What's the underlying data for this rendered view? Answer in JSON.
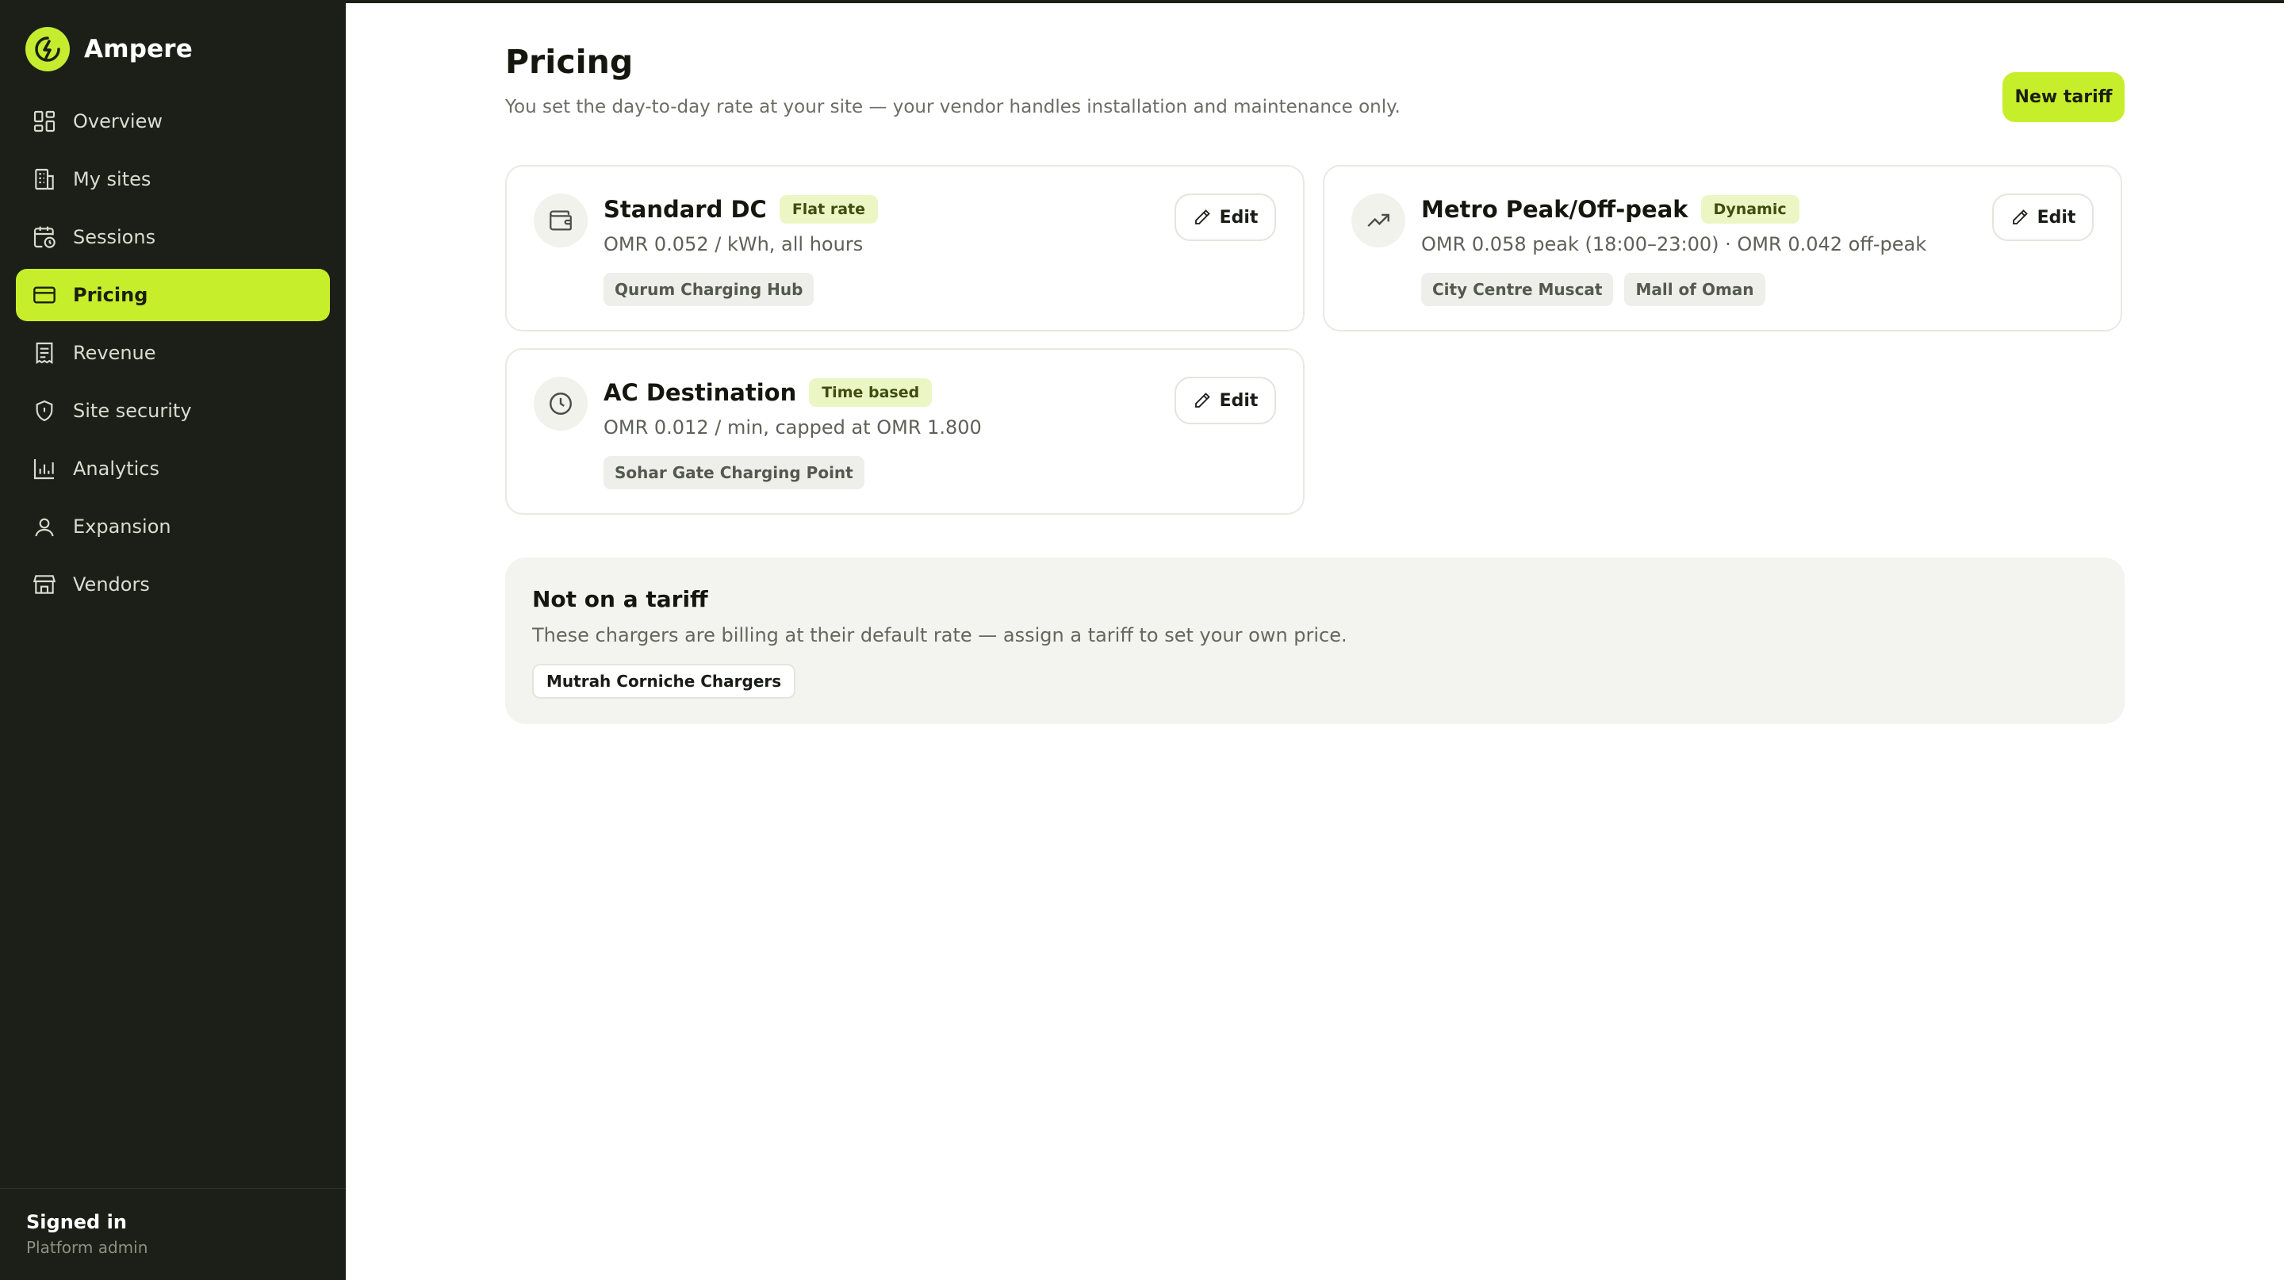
{
  "app": {
    "name": "Ampere",
    "accent": "#c7ee2b",
    "sidebar_bg": "#1c1f17"
  },
  "sidebar": {
    "items": [
      {
        "label": "Overview",
        "icon": "grid-icon"
      },
      {
        "label": "My sites",
        "icon": "building-icon"
      },
      {
        "label": "Sessions",
        "icon": "calendar-clock-icon"
      },
      {
        "label": "Pricing",
        "icon": "credit-card-icon",
        "active": true
      },
      {
        "label": "Revenue",
        "icon": "receipt-icon"
      },
      {
        "label": "Site security",
        "icon": "shield-icon"
      },
      {
        "label": "Analytics",
        "icon": "bar-chart-icon"
      },
      {
        "label": "Expansion",
        "icon": "map-pin-user-icon"
      },
      {
        "label": "Vendors",
        "icon": "store-icon"
      }
    ],
    "footer": {
      "title": "Signed in",
      "subtitle": "Platform admin"
    }
  },
  "main": {
    "title": "Pricing",
    "subtitle": "You set the day-to-day rate at your site — your vendor handles installation and maintenance only.",
    "new_button": "New tariff",
    "tariffs": [
      {
        "name": "Standard DC",
        "badge": "Flat rate",
        "rate": "OMR 0.052 / kWh, all hours",
        "sites": [
          "Qurum Charging Hub"
        ],
        "icon": "wallet-icon",
        "edit": "Edit"
      },
      {
        "name": "Metro Peak/Off-peak",
        "badge": "Dynamic",
        "rate": "OMR 0.058 peak (18:00–23:00) · OMR 0.042 off-peak",
        "sites": [
          "City Centre Muscat",
          "Mall of Oman"
        ],
        "icon": "trending-up-icon",
        "edit": "Edit"
      },
      {
        "name": "AC Destination",
        "badge": "Time based",
        "rate": "OMR 0.012 / min, capped at OMR 1.800",
        "sites": [
          "Sohar Gate Charging Point"
        ],
        "icon": "clock-icon",
        "edit": "Edit"
      }
    ],
    "not_on_tariff": {
      "title": "Not on a tariff",
      "subtitle": "These chargers are billing at their default rate — assign a tariff to set your own price.",
      "sites": [
        "Mutrah Corniche Chargers"
      ]
    }
  }
}
